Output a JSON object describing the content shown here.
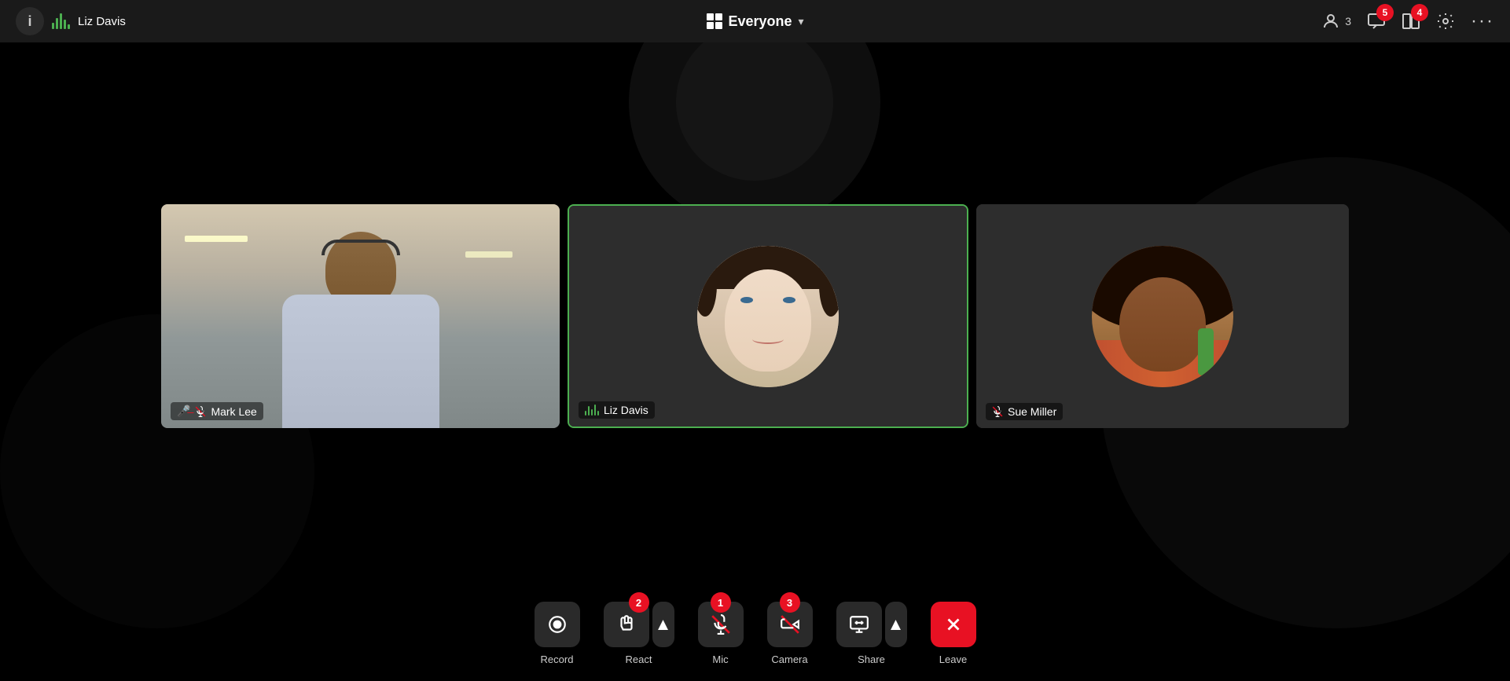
{
  "header": {
    "info_label": "i",
    "user_name": "Liz Davis",
    "everyone_label": "Everyone",
    "participant_count": "3",
    "badge_chat": "5",
    "badge_panel": "4"
  },
  "participants": [
    {
      "id": "mark-lee",
      "name": "Mark Lee",
      "muted": true,
      "speaking": false,
      "type": "video"
    },
    {
      "id": "liz-davis",
      "name": "Liz Davis",
      "muted": false,
      "speaking": true,
      "type": "avatar",
      "active": true
    },
    {
      "id": "sue-miller",
      "name": "Sue Miller",
      "muted": true,
      "speaking": false,
      "type": "avatar"
    }
  ],
  "toolbar": {
    "record_label": "Record",
    "react_label": "React",
    "mic_label": "Mic",
    "camera_label": "Camera",
    "share_label": "Share",
    "leave_label": "Leave",
    "react_badge": "2",
    "mic_badge": "1",
    "camera_badge": "3"
  }
}
